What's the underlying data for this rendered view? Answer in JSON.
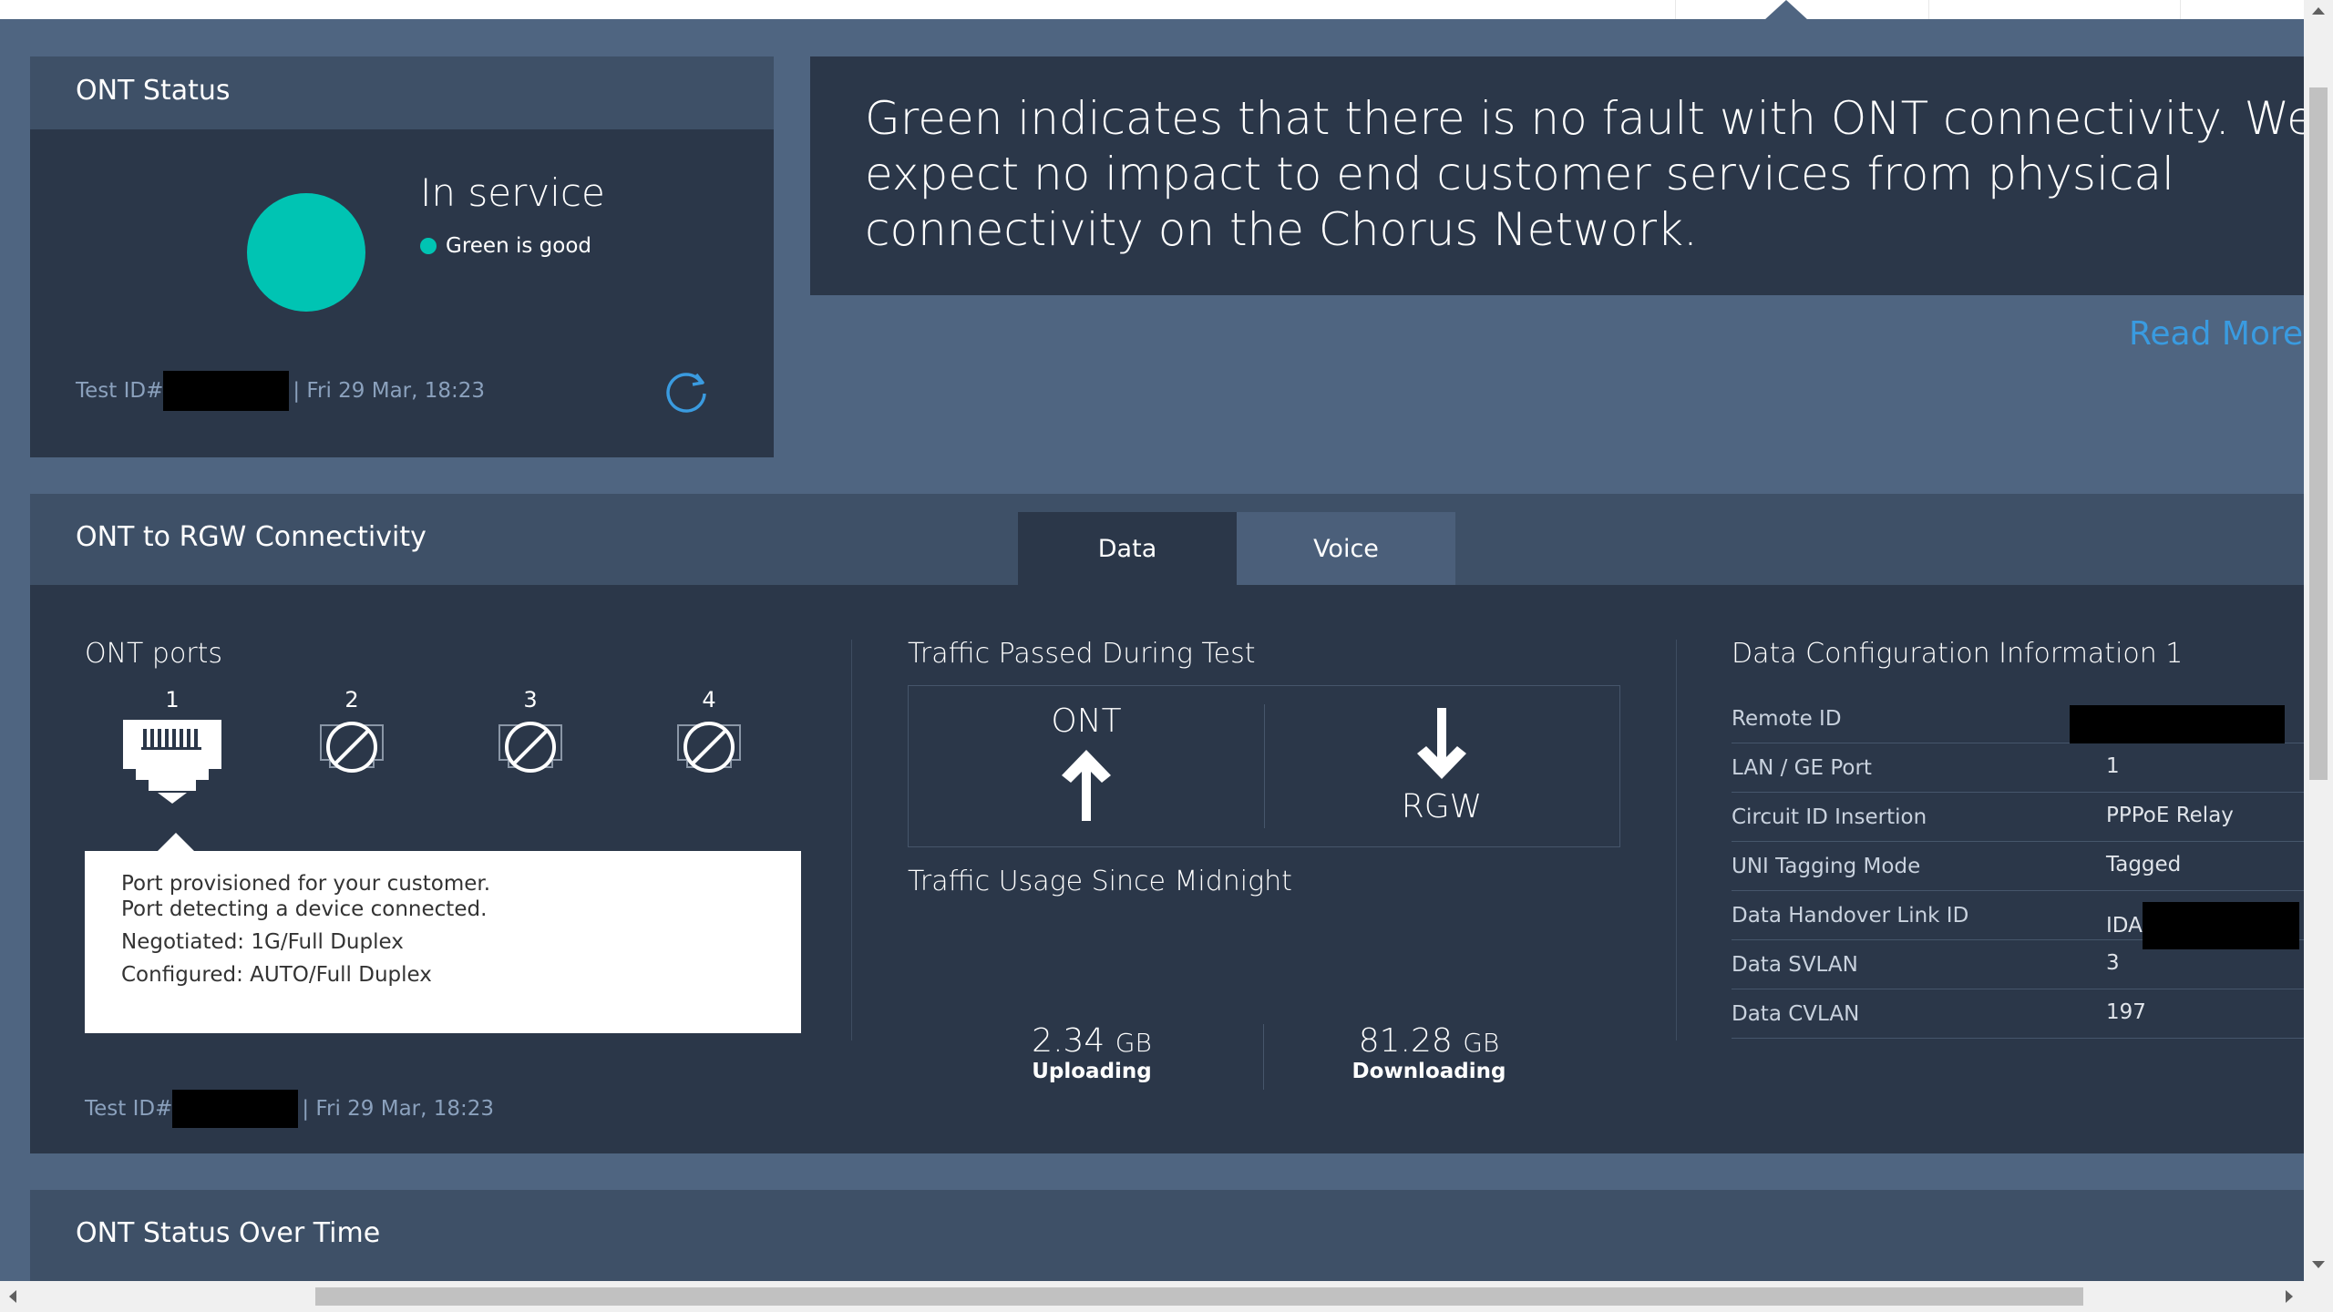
{
  "ont_status": {
    "title": "ONT Status",
    "status": "In service",
    "status_hint": "Green is good",
    "status_color": "#00c4b3",
    "test_id_label": "Test ID#",
    "test_time": "| Fri 29 Mar, 18:23",
    "refresh_icon": "refresh-icon"
  },
  "info": {
    "message": "Green indicates that there is no fault with ONT connectivity. We expect no impact to end customer services from physical connectivity on the Chorus Network.",
    "read_more": "Read More"
  },
  "connectivity": {
    "title": "ONT to RGW Connectivity",
    "tabs": [
      {
        "label": "Data",
        "active": true
      },
      {
        "label": "Voice",
        "active": false
      }
    ],
    "ports_title": "ONT ports",
    "ports": [
      {
        "num": "1",
        "state": "connected"
      },
      {
        "num": "2",
        "state": "disabled"
      },
      {
        "num": "3",
        "state": "disabled"
      },
      {
        "num": "4",
        "state": "disabled"
      }
    ],
    "tooltip": {
      "line1": "Port provisioned for your customer.",
      "line2": "Port detecting a device connected.",
      "line3": "Negotiated: 1G/Full Duplex",
      "line4": "Configured: AUTO/Full Duplex"
    },
    "traffic_title": "Traffic Passed During Test",
    "traffic_ont": "ONT",
    "traffic_rgw": "RGW",
    "usage_title": "Traffic Usage Since Midnight",
    "upload_value": "2.34",
    "upload_unit": "GB",
    "upload_label": "Uploading",
    "download_value": "81.28",
    "download_unit": "GB",
    "download_label": "Downloading",
    "config_title": "Data Configuration Information 1",
    "config": [
      {
        "key": "Remote ID",
        "value": ""
      },
      {
        "key": "LAN / GE Port",
        "value": "1"
      },
      {
        "key": "Circuit ID Insertion",
        "value": "PPPoE Relay"
      },
      {
        "key": "UNI Tagging Mode",
        "value": "Tagged"
      },
      {
        "key": "Data Handover Link ID",
        "value": "IDA"
      },
      {
        "key": "Data SVLAN",
        "value": "3"
      },
      {
        "key": "Data CVLAN",
        "value": "197"
      }
    ],
    "test_id_label": "Test ID#",
    "test_time": "| Fri 29 Mar, 18:23"
  },
  "over_time": {
    "title": "ONT Status Over Time"
  },
  "colors": {
    "background": "#4f6581",
    "panel": "#2b3749",
    "panel_header": "#3e5067",
    "link": "#3a9be0"
  }
}
